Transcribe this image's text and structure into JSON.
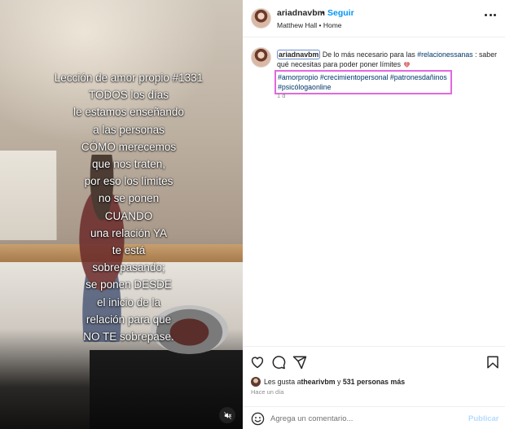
{
  "media": {
    "overlay_lines": [
      "Lección de amor propio #1331",
      "TODOS los días",
      "le estamos enseñando",
      "a las personas",
      "CÓMO merecemos",
      "que nos traten,",
      "por eso los límites",
      "no se ponen",
      "CUANDO",
      "una relación YA",
      "te está",
      "sobrepasando;",
      "se ponen DESDE",
      "el inicio de la",
      "relación para que",
      "NO TE sobrepase."
    ],
    "mute_icon": "speaker-muted-icon"
  },
  "header": {
    "username": "ariadnavbm",
    "separator": "•",
    "follow_label": "Seguir",
    "location": "Matthew Hall • Home",
    "more_icon": "more-options-icon"
  },
  "caption": {
    "username": "ariadnavbm",
    "text_before": " De lo más necesario para las ",
    "hashtag_1": "#relacionessanas",
    "text_after": " : saber qué necesitas para poder poner límites ",
    "emoji": "heart-emoji",
    "hashtags_boxed_line1": "#amorpropio #crecimientopersonal #patronesdañinos",
    "hashtags_boxed_line2": "#psicólogaonline",
    "time": "1 d"
  },
  "actions": {
    "like_icon": "heart-outline-icon",
    "comment_icon": "comment-icon",
    "share_icon": "share-icon",
    "save_icon": "bookmark-icon",
    "likes_prefix": "Les gusta a ",
    "likes_user": "thearivbm",
    "likes_connector": " y ",
    "likes_count": "531 personas más",
    "time_ago": "Hace un día"
  },
  "comment": {
    "placeholder": "Agrega un comentario...",
    "publish_label": "Publicar",
    "emoji_icon": "emoji-smiley-icon"
  },
  "colors": {
    "follow_blue": "#0095f6",
    "hashtag_blue": "#00376b",
    "highlight_pink": "#e268e0",
    "publish_disabled": "#b3dbff"
  }
}
